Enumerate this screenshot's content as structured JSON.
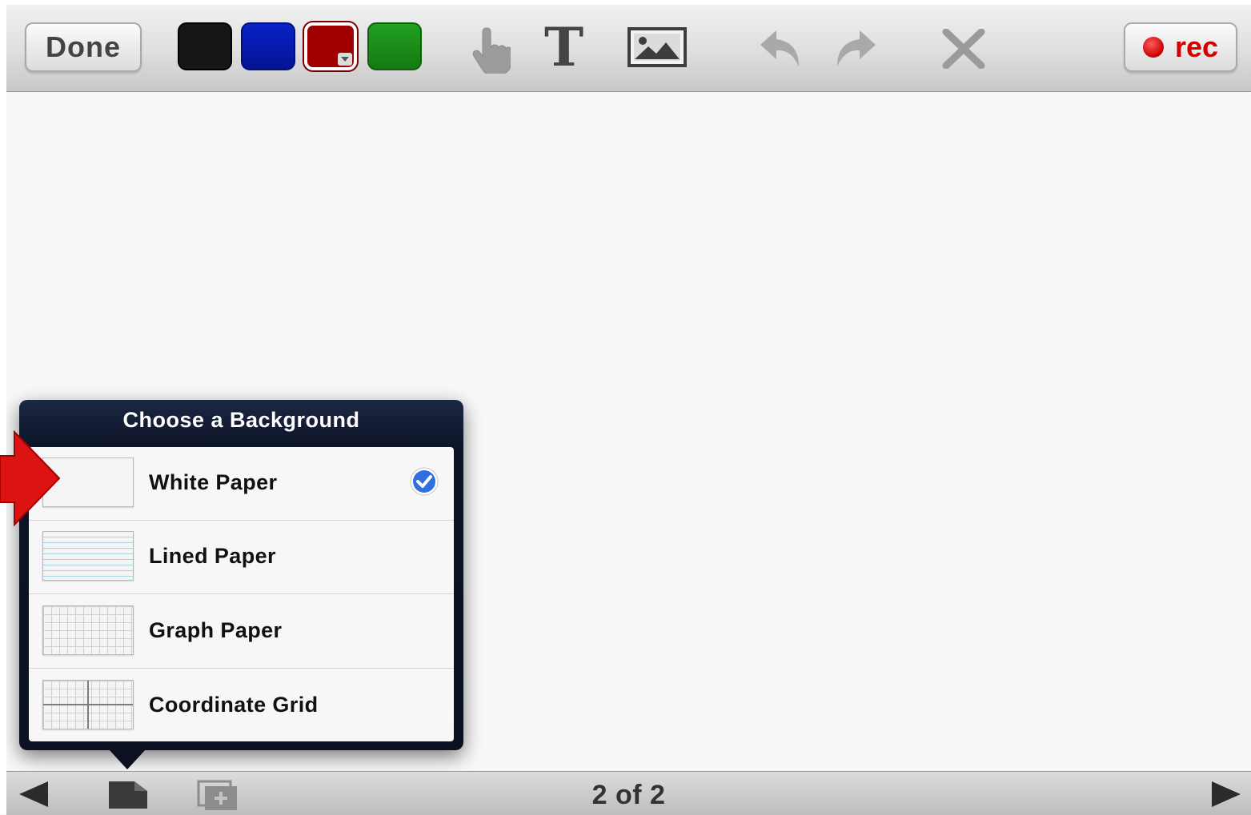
{
  "toolbar": {
    "done_label": "Done",
    "rec_label": "rec",
    "colors": [
      {
        "name": "black",
        "hex": "#161616"
      },
      {
        "name": "blue",
        "hex": "#0a22c8"
      },
      {
        "name": "red",
        "hex": "#a00000",
        "selected": true
      },
      {
        "name": "green",
        "hex": "#22a020"
      }
    ],
    "tools": [
      "hand-icon",
      "text-icon",
      "image-icon",
      "undo-icon",
      "redo-icon",
      "clear-icon"
    ]
  },
  "background_popover": {
    "title": "Choose a Background",
    "options": [
      {
        "label": "White Paper",
        "selected": true
      },
      {
        "label": "Lined Paper",
        "selected": false
      },
      {
        "label": "Graph Paper",
        "selected": false
      },
      {
        "label": "Coordinate Grid",
        "selected": false
      }
    ]
  },
  "bottom_bar": {
    "page_counter": "2 of 2"
  }
}
